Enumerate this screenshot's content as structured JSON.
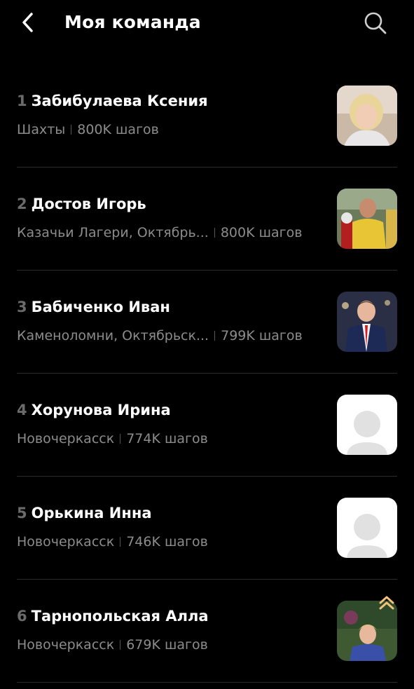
{
  "header": {
    "title": "Моя команда"
  },
  "team": [
    {
      "rank": "1",
      "name": "Забибулаева Ксения",
      "location": "Шахты",
      "steps": "800K шагов",
      "avatar": "photo-woman-blonde"
    },
    {
      "rank": "2",
      "name": "Достов Игорь",
      "location": "Казачьи Лагери, Октябрь...",
      "steps": "800K шагов",
      "avatar": "photo-hockey-player"
    },
    {
      "rank": "3",
      "name": "Бабиченко Иван",
      "location": "Каменоломни, Октябрьск...",
      "steps": "799K шагов",
      "avatar": "photo-man-suit"
    },
    {
      "rank": "4",
      "name": "Хорунова Ирина",
      "location": "Новочеркасск",
      "steps": "774K шагов",
      "avatar": "placeholder-avatar"
    },
    {
      "rank": "5",
      "name": "Орькина Инна",
      "location": "Новочеркасск",
      "steps": "746K шагов",
      "avatar": "placeholder-avatar"
    },
    {
      "rank": "6",
      "name": "Тарнопольская Алла",
      "location": "Новочеркасск",
      "steps": "679K шагов",
      "avatar": "photo-woman-outdoor",
      "badge": "double-chevron-up-icon"
    }
  ],
  "colors": {
    "background": "#000000",
    "text": "#ffffff",
    "secondary": "#8c8c8c",
    "rank": "#6b6b6b",
    "badge": "#f2c27a"
  }
}
